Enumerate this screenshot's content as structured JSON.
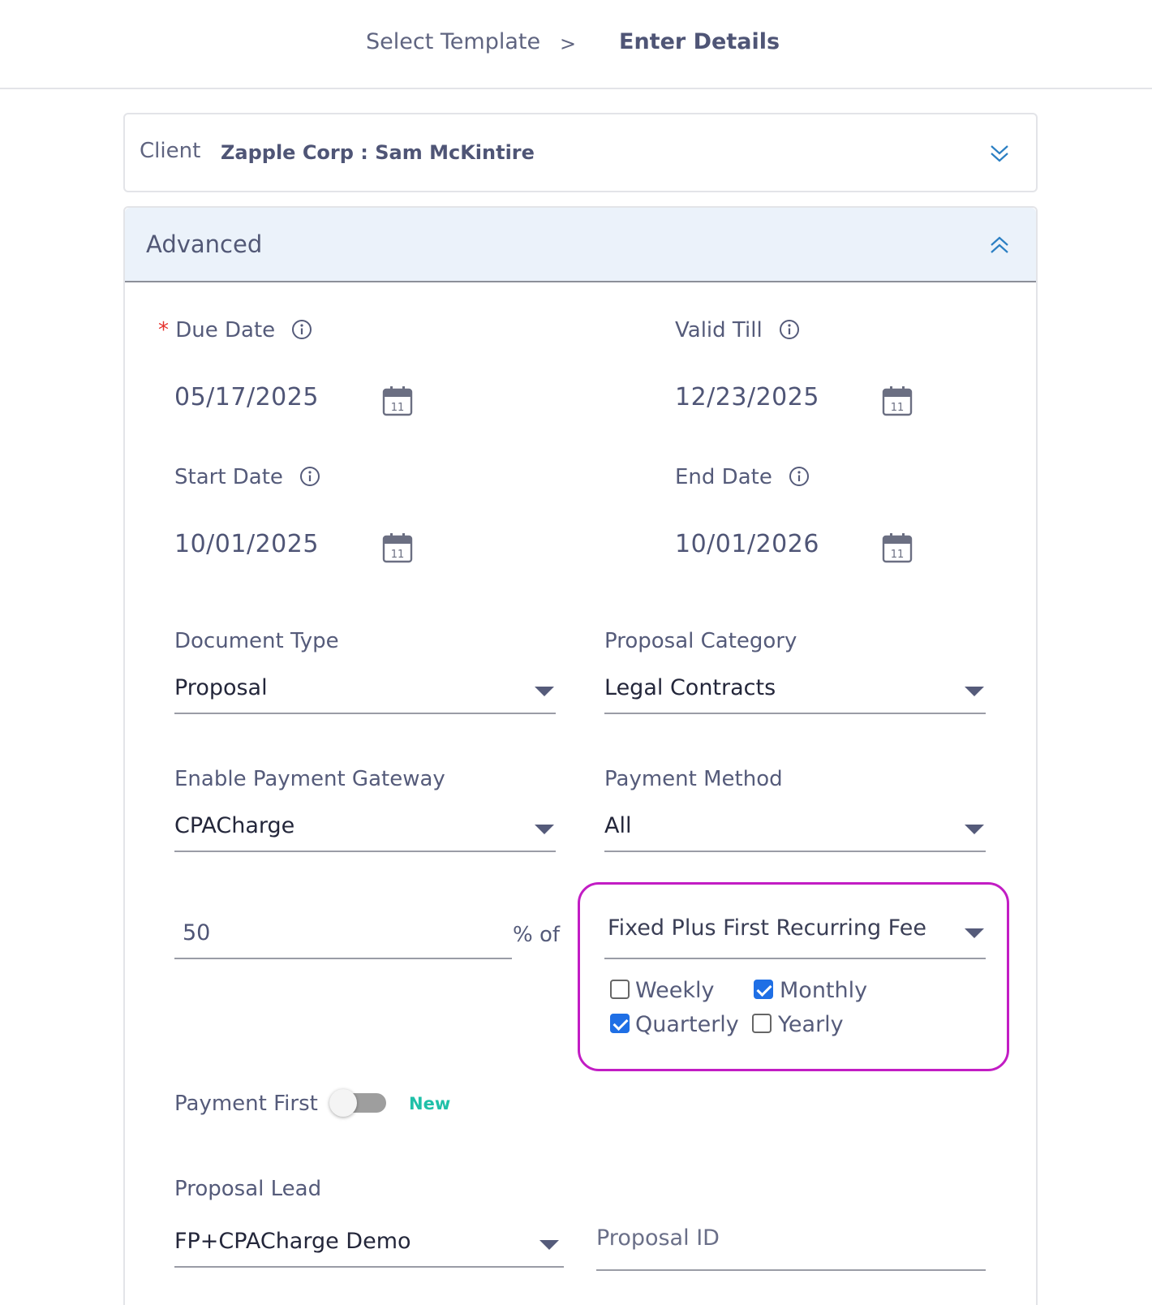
{
  "breadcrumb": {
    "step1": "Select Template",
    "separator": ">",
    "step2": "Enter Details"
  },
  "client": {
    "label": "Client",
    "name": "Zapple Corp : Sam McKintire"
  },
  "advanced": {
    "title": "Advanced",
    "due_date": {
      "required_mark": "*",
      "label": "Due Date",
      "value": "05/17/2025"
    },
    "valid_till": {
      "label": "Valid Till",
      "value": "12/23/2025"
    },
    "start_date": {
      "label": "Start Date",
      "value": "10/01/2025"
    },
    "end_date": {
      "label": "End Date",
      "value": "10/01/2026"
    },
    "document_type": {
      "label": "Document Type",
      "value": "Proposal"
    },
    "proposal_category": {
      "label": "Proposal Category",
      "value": "Legal Contracts"
    },
    "payment_gateway": {
      "label": "Enable Payment Gateway",
      "value": "CPACharge"
    },
    "payment_method": {
      "label": "Payment Method",
      "value": "All"
    },
    "percent": {
      "value": "50",
      "suffix": "% of"
    },
    "fee_basis": {
      "value": "Fixed Plus First Recurring Fee"
    },
    "frequencies": {
      "weekly": {
        "label": "Weekly",
        "checked": false
      },
      "monthly": {
        "label": "Monthly",
        "checked": true
      },
      "quarterly": {
        "label": "Quarterly",
        "checked": true
      },
      "yearly": {
        "label": "Yearly",
        "checked": false
      }
    },
    "payment_first": {
      "label": "Payment First",
      "enabled": false,
      "badge": "New"
    },
    "proposal_lead": {
      "label": "Proposal Lead",
      "value": "FP+CPACharge Demo"
    },
    "proposal_id": {
      "placeholder": "Proposal ID"
    }
  },
  "colors": {
    "highlight": "#c21dc4",
    "accent": "#1f6fe5",
    "header_bg": "#ebf2fa",
    "new_badge": "#1fc0a8",
    "required": "#e5322d"
  },
  "icons": {
    "info": "info-icon",
    "calendar": "calendar-icon",
    "expand": "chevron-double-down-icon",
    "collapse": "chevron-double-up-icon"
  }
}
